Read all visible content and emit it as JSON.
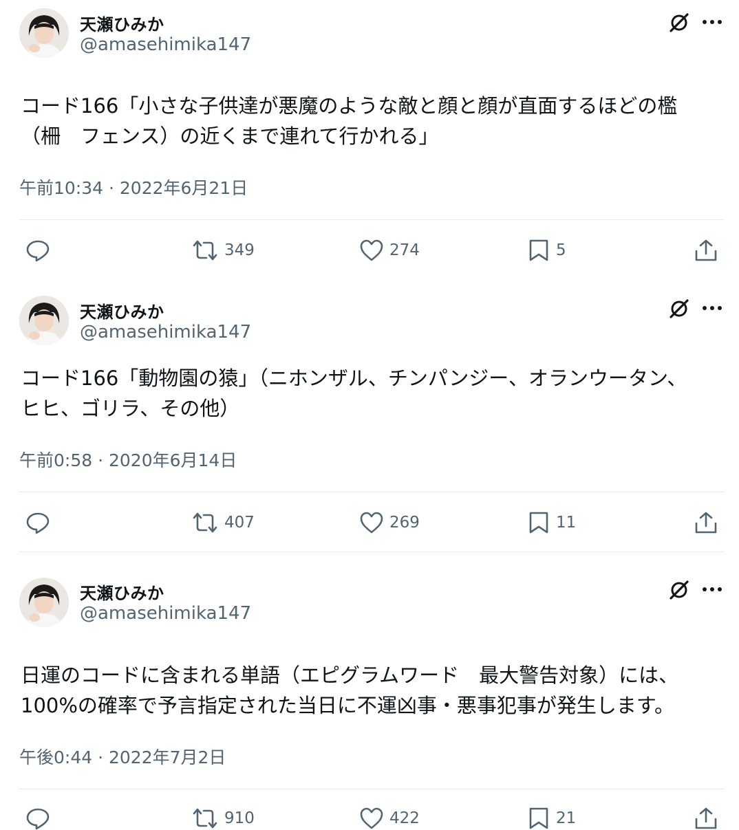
{
  "tweets": [
    {
      "display_name": "天瀬ひみか",
      "handle": "@amasehimika147",
      "text_lines": [
        "コード166「小さな子供達が悪魔のような敵と顔と顔が直面するほどの檻",
        "（柵　フェンス）の近くまで連れて行かれる」"
      ],
      "timestamp": "午前10:34 · 2022年6月21日",
      "retweets": "349",
      "likes": "274",
      "bookmarks": "5"
    },
    {
      "display_name": "天瀬ひみか",
      "handle": "@amasehimika147",
      "text_lines": [
        "コード166「動物園の猿」（ニホンザル、チンパンジー、オランウータン、",
        "ヒヒ、ゴリラ、その他）"
      ],
      "timestamp": "午前0:58 · 2020年6月14日",
      "retweets": "407",
      "likes": "269",
      "bookmarks": "11"
    },
    {
      "display_name": "天瀬ひみか",
      "handle": "@amasehimika147",
      "text_lines": [
        "日運のコードに含まれる単語（エピグラムワード　最大警告対象）には、",
        "100%の確率で予言指定された当日に不運凶事・悪事犯事が発生します。"
      ],
      "timestamp": "午後0:44 · 2022年7月2日",
      "retweets": "910",
      "likes": "422",
      "bookmarks": "21"
    }
  ],
  "icons": {
    "reply": "reply-icon",
    "retweet": "retweet-icon",
    "like": "heart-icon",
    "bookmark": "bookmark-icon",
    "share": "share-icon",
    "grok": "grok-icon",
    "more": "more-icon"
  },
  "colors": {
    "text": "#0f1419",
    "secondary": "#536471",
    "divider": "#e7e9ea"
  }
}
